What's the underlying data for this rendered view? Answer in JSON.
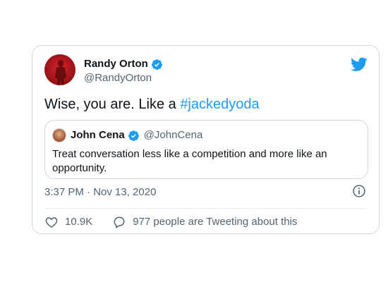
{
  "tweet": {
    "author": {
      "name": "Randy Orton",
      "handle": "@RandyOrton",
      "verified": true,
      "avatar": "red-portrait-avatar"
    },
    "text_prefix": "Wise, you are. Like a ",
    "hashtag": "#jackedyoda",
    "timestamp": "3:37 PM · Nov 13, 2020",
    "likes": "10.9K",
    "conversation_text": "977 people are Tweeting about this"
  },
  "quote": {
    "author": {
      "name": "John Cena",
      "handle": "@JohnCena",
      "verified": true
    },
    "text": "Treat conversation less like a competition and more like an opportunity."
  },
  "icons": {
    "brand": "twitter-bird-icon",
    "verified": "verified-badge-icon",
    "info": "info-icon",
    "like": "heart-icon",
    "reply": "speech-bubble-icon"
  },
  "colors": {
    "brand_blue": "#1d9bf0",
    "text": "#0f1419",
    "secondary_text": "#536471",
    "border": "#cfd9de"
  }
}
